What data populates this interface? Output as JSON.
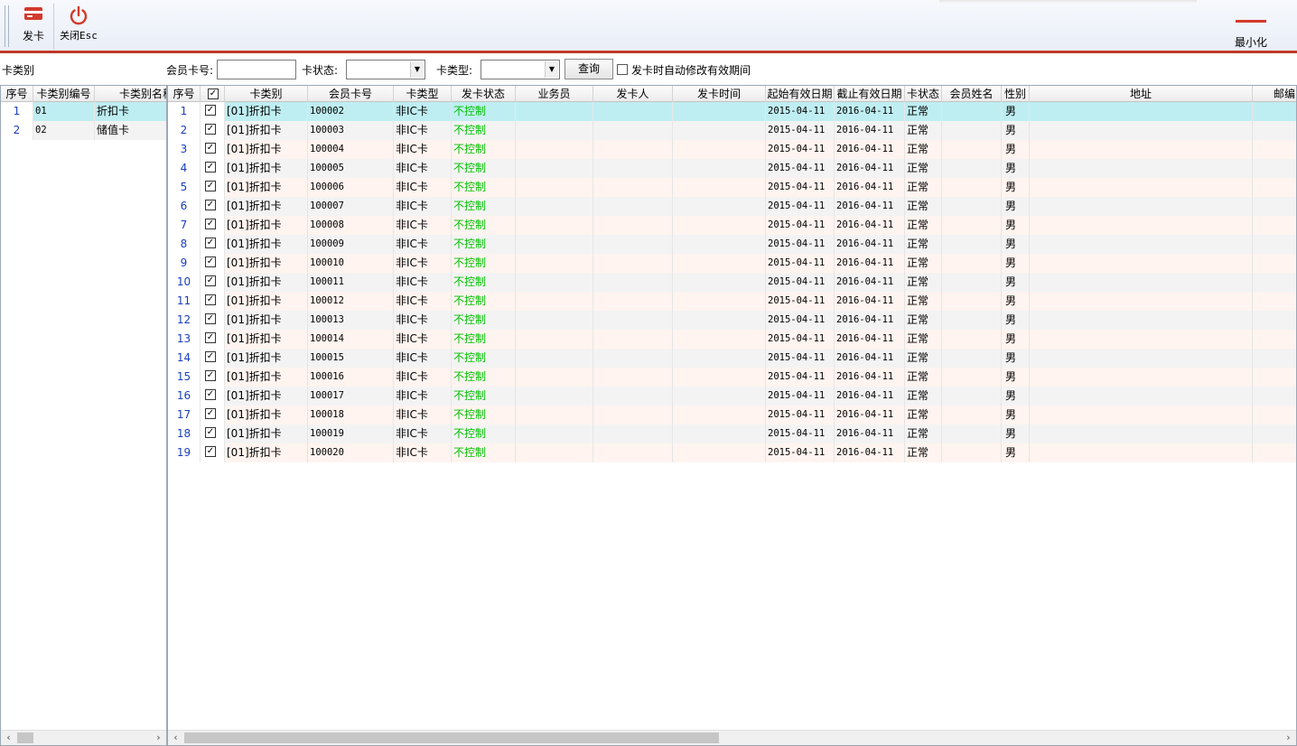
{
  "toolbar": {
    "issue_card_label": "发卡",
    "close_label": "关闭Esc",
    "minimize_label": "最小化"
  },
  "filter": {
    "card_category_label": "卡类别",
    "member_card_no_label": "会员卡号:",
    "member_card_no_value": "",
    "card_status_label": "卡状态:",
    "card_status_value": "",
    "card_type_label": "卡类型:",
    "card_type_value": "",
    "query_button": "查询",
    "auto_modify_label": "发卡时自动修改有效期间",
    "auto_modify_checked": false
  },
  "left_grid": {
    "columns": [
      "序号",
      "卡类别编号",
      "卡类别名称"
    ],
    "rows": [
      {
        "no": "1",
        "code": "01",
        "name": "折扣卡",
        "selected": true
      },
      {
        "no": "2",
        "code": "02",
        "name": "储值卡",
        "selected": false
      }
    ]
  },
  "main_grid": {
    "columns": [
      "序号",
      "",
      "卡类别",
      "会员卡号",
      "卡类型",
      "发卡状态",
      "业务员",
      "发卡人",
      "发卡时间",
      "起始有效日期",
      "截止有效日期",
      "卡状态",
      "会员姓名",
      "性别",
      "地址",
      "邮编"
    ],
    "rows": [
      {
        "no": "1",
        "checked": true,
        "category": "[01]折扣卡",
        "card_no": "100002",
        "card_type": "非IC卡",
        "issue_status": "不控制",
        "start": "2015-04-11",
        "end": "2016-04-11",
        "status": "正常",
        "gender": "男"
      },
      {
        "no": "2",
        "checked": true,
        "category": "[01]折扣卡",
        "card_no": "100003",
        "card_type": "非IC卡",
        "issue_status": "不控制",
        "start": "2015-04-11",
        "end": "2016-04-11",
        "status": "正常",
        "gender": "男"
      },
      {
        "no": "3",
        "checked": true,
        "category": "[01]折扣卡",
        "card_no": "100004",
        "card_type": "非IC卡",
        "issue_status": "不控制",
        "start": "2015-04-11",
        "end": "2016-04-11",
        "status": "正常",
        "gender": "男"
      },
      {
        "no": "4",
        "checked": true,
        "category": "[01]折扣卡",
        "card_no": "100005",
        "card_type": "非IC卡",
        "issue_status": "不控制",
        "start": "2015-04-11",
        "end": "2016-04-11",
        "status": "正常",
        "gender": "男"
      },
      {
        "no": "5",
        "checked": true,
        "category": "[01]折扣卡",
        "card_no": "100006",
        "card_type": "非IC卡",
        "issue_status": "不控制",
        "start": "2015-04-11",
        "end": "2016-04-11",
        "status": "正常",
        "gender": "男"
      },
      {
        "no": "6",
        "checked": true,
        "category": "[01]折扣卡",
        "card_no": "100007",
        "card_type": "非IC卡",
        "issue_status": "不控制",
        "start": "2015-04-11",
        "end": "2016-04-11",
        "status": "正常",
        "gender": "男"
      },
      {
        "no": "7",
        "checked": true,
        "category": "[01]折扣卡",
        "card_no": "100008",
        "card_type": "非IC卡",
        "issue_status": "不控制",
        "start": "2015-04-11",
        "end": "2016-04-11",
        "status": "正常",
        "gender": "男"
      },
      {
        "no": "8",
        "checked": true,
        "category": "[01]折扣卡",
        "card_no": "100009",
        "card_type": "非IC卡",
        "issue_status": "不控制",
        "start": "2015-04-11",
        "end": "2016-04-11",
        "status": "正常",
        "gender": "男"
      },
      {
        "no": "9",
        "checked": true,
        "category": "[01]折扣卡",
        "card_no": "100010",
        "card_type": "非IC卡",
        "issue_status": "不控制",
        "start": "2015-04-11",
        "end": "2016-04-11",
        "status": "正常",
        "gender": "男"
      },
      {
        "no": "10",
        "checked": true,
        "category": "[01]折扣卡",
        "card_no": "100011",
        "card_type": "非IC卡",
        "issue_status": "不控制",
        "start": "2015-04-11",
        "end": "2016-04-11",
        "status": "正常",
        "gender": "男"
      },
      {
        "no": "11",
        "checked": true,
        "category": "[01]折扣卡",
        "card_no": "100012",
        "card_type": "非IC卡",
        "issue_status": "不控制",
        "start": "2015-04-11",
        "end": "2016-04-11",
        "status": "正常",
        "gender": "男"
      },
      {
        "no": "12",
        "checked": true,
        "category": "[01]折扣卡",
        "card_no": "100013",
        "card_type": "非IC卡",
        "issue_status": "不控制",
        "start": "2015-04-11",
        "end": "2016-04-11",
        "status": "正常",
        "gender": "男"
      },
      {
        "no": "13",
        "checked": true,
        "category": "[01]折扣卡",
        "card_no": "100014",
        "card_type": "非IC卡",
        "issue_status": "不控制",
        "start": "2015-04-11",
        "end": "2016-04-11",
        "status": "正常",
        "gender": "男"
      },
      {
        "no": "14",
        "checked": true,
        "category": "[01]折扣卡",
        "card_no": "100015",
        "card_type": "非IC卡",
        "issue_status": "不控制",
        "start": "2015-04-11",
        "end": "2016-04-11",
        "status": "正常",
        "gender": "男"
      },
      {
        "no": "15",
        "checked": true,
        "category": "[01]折扣卡",
        "card_no": "100016",
        "card_type": "非IC卡",
        "issue_status": "不控制",
        "start": "2015-04-11",
        "end": "2016-04-11",
        "status": "正常",
        "gender": "男"
      },
      {
        "no": "16",
        "checked": true,
        "category": "[01]折扣卡",
        "card_no": "100017",
        "card_type": "非IC卡",
        "issue_status": "不控制",
        "start": "2015-04-11",
        "end": "2016-04-11",
        "status": "正常",
        "gender": "男"
      },
      {
        "no": "17",
        "checked": true,
        "category": "[01]折扣卡",
        "card_no": "100018",
        "card_type": "非IC卡",
        "issue_status": "不控制",
        "start": "2015-04-11",
        "end": "2016-04-11",
        "status": "正常",
        "gender": "男"
      },
      {
        "no": "18",
        "checked": true,
        "category": "[01]折扣卡",
        "card_no": "100019",
        "card_type": "非IC卡",
        "issue_status": "不控制",
        "start": "2015-04-11",
        "end": "2016-04-11",
        "status": "正常",
        "gender": "男"
      },
      {
        "no": "19",
        "checked": true,
        "category": "[01]折扣卡",
        "card_no": "100020",
        "card_type": "非IC卡",
        "issue_status": "不控制",
        "start": "2015-04-11",
        "end": "2016-04-11",
        "status": "正常",
        "gender": "男"
      }
    ]
  },
  "icons": {
    "issue_card": "card-icon",
    "close": "power-icon",
    "minimize": "minimize-icon"
  },
  "colors": {
    "accent_red": "#c0392b",
    "selected_row": "#bfeef2",
    "alt_row_pink": "#fff4ef",
    "alt_row_gray": "#f3f3f3",
    "index_blue": "#1a3fbf",
    "status_green": "#00c000"
  }
}
